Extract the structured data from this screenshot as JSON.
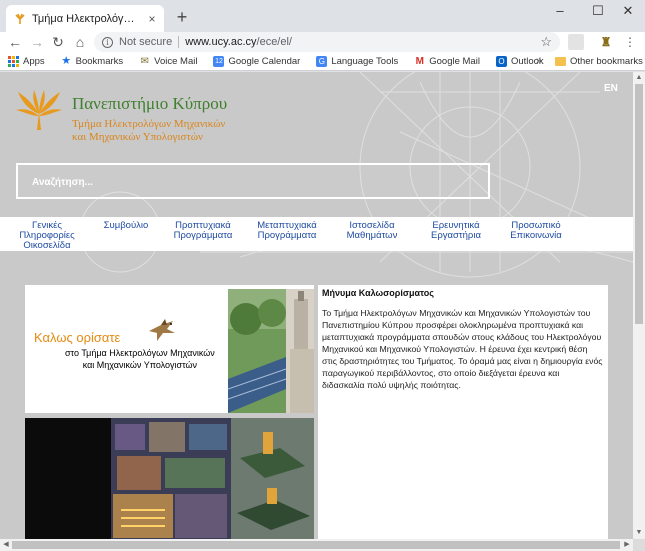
{
  "browser": {
    "tab_title": "Τμήμα Ηλεκτρολόγων Μηχανικώ",
    "tab_close": "×",
    "new_tab": "+",
    "window_controls": {
      "minimize": "–",
      "maximize": "☐",
      "close": "✕"
    },
    "nav": {
      "back": "←",
      "forward": "→",
      "reload": "↻",
      "home": "⌂"
    },
    "security_label": "Not secure",
    "url_domain": "www.ucy.ac.cy",
    "url_path": "/ece/el/",
    "bookmarks": [
      {
        "label": "Apps",
        "icon": "apps-grid-icon",
        "color": "#e0562a"
      },
      {
        "label": "Bookmarks",
        "icon": "star-icon",
        "color": "#1a73e8"
      },
      {
        "label": "Voice Mail",
        "icon": "voicemail-icon",
        "color": "#7b6f2a"
      },
      {
        "label": "Google Calendar",
        "icon": "calendar-icon",
        "color": "#4285f4"
      },
      {
        "label": "Language Tools",
        "icon": "translate-icon",
        "color": "#4285f4"
      },
      {
        "label": "Google Mail",
        "icon": "gmail-icon",
        "color": "#d93025"
      },
      {
        "label": "Outlook",
        "icon": "outlook-icon",
        "color": "#0a64c8"
      }
    ],
    "bookmarks_more": "»",
    "other_bookmarks": "Other bookmarks"
  },
  "page": {
    "university_name": "Πανεπιστήμιο Κύπρου",
    "department_line1": "Τμήμα Ηλεκτρολόγων Μηχανικών",
    "department_line2": "και Μηχανικών Υπολογιστών",
    "language_switch": "EN",
    "search_placeholder": "Αναζήτηση...",
    "menu": [
      {
        "line1": "Γενικές",
        "line2": "Πληροφορίες",
        "line3": "Οικοσελίδα"
      },
      {
        "line1": "Συμβούλιο",
        "line2": "",
        "line3": ""
      },
      {
        "line1": "Προπτυχιακά",
        "line2": "Προγράμματα",
        "line3": ""
      },
      {
        "line1": "Μεταπτυχιακά",
        "line2": "Προγράμματα",
        "line3": ""
      },
      {
        "line1": "Ιστοσελίδα",
        "line2": "Μαθημάτων",
        "line3": ""
      },
      {
        "line1": "Ερευνητικά",
        "line2": "Εργαστήρια",
        "line3": ""
      },
      {
        "line1": "Προσωπικό",
        "line2": "Επικοινωνία",
        "line3": ""
      }
    ],
    "welcome_banner": {
      "title": "Καλως ορίσατε",
      "sub_line1": "στο Τμήμα Ηλεκτρολόγων Μηχανικών",
      "sub_line2": "και Μηχανικών Υπολογιστών"
    },
    "message": {
      "heading": "Μήνυμα Καλωσορίσματος",
      "body": "Το Τμήμα Ηλεκτρολόγων Μηχανικών και Μηχανικών Υπολογιστών του Πανεπιστημίου Κύπρου προσφέρει ολοκληρωμένα προπτυχιακά και μεταπτυχιακά προγράμματα σπουδών στους κλάδους του Ηλεκτρολόγου Μηχανικού και Μηχανικού Υπολογιστών. Η έρευνα έχει κεντρική θέση στις δραστηριότητες του Τμήματος. Το όραμά μας είναι η δημιουργία ενός παραγωγικού περιβάλλοντος, στο οποίο διεξάγεται έρευνα και διδασκαλία πολύ υψηλής ποιότητας."
    }
  },
  "colors": {
    "uni_green": "#3f7f2f",
    "dept_orange": "#d9851b",
    "menu_blue": "#1e4ba1",
    "hero_gray": "#c9c9c9",
    "welcome_orange": "#e58a12"
  }
}
